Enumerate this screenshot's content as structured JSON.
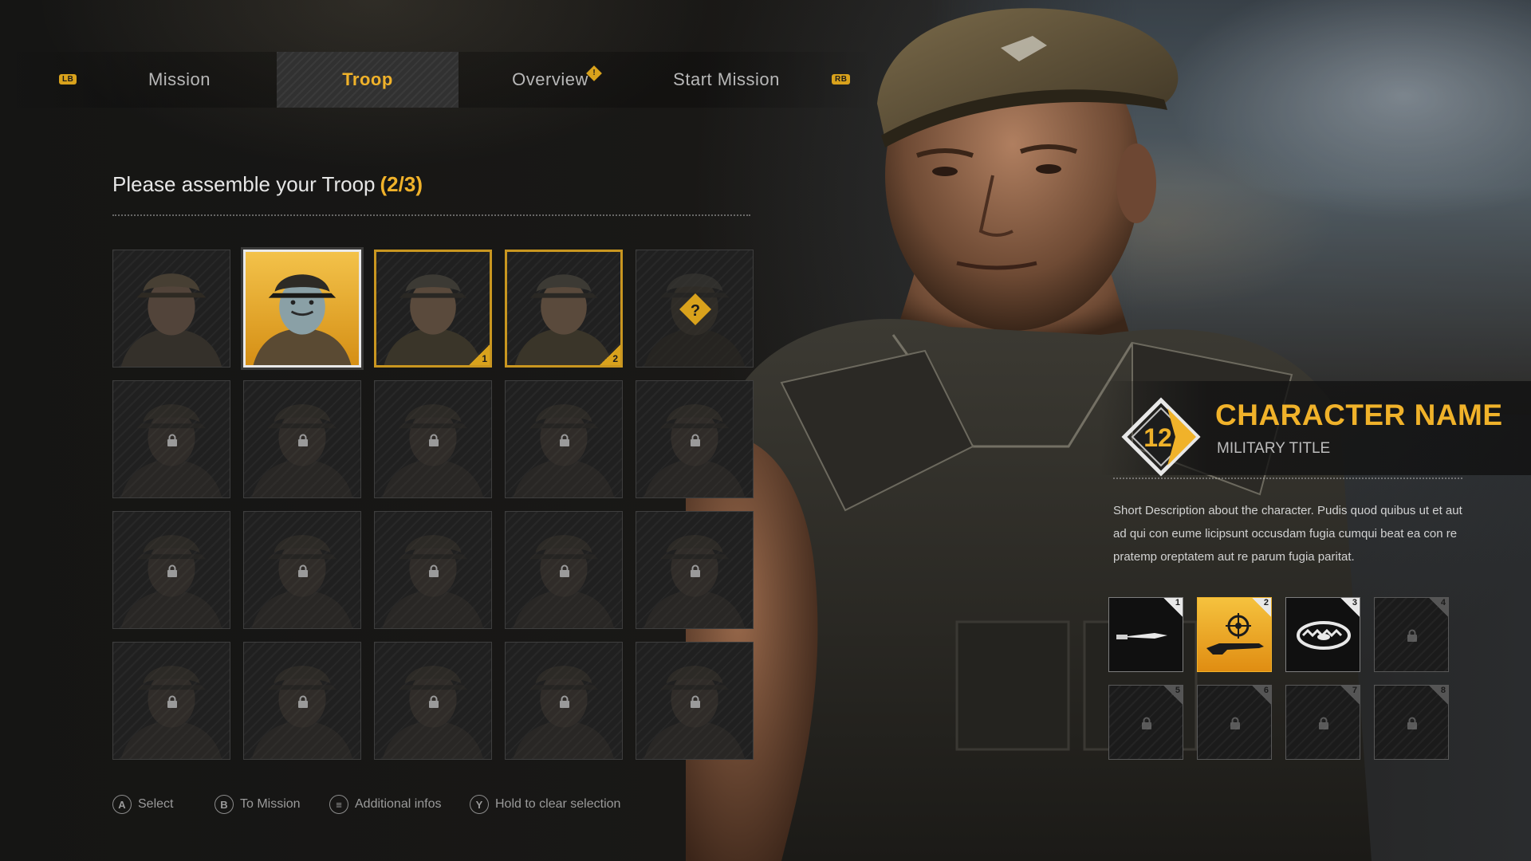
{
  "tabs": {
    "left_bumper": "LB",
    "right_bumper": "RB",
    "items": [
      {
        "label": "Mission"
      },
      {
        "label": "Troop"
      },
      {
        "label": "Overview"
      },
      {
        "label": "Start Mission"
      }
    ],
    "active": "Troop",
    "overview_alert": "!"
  },
  "heading": {
    "text": "Please assemble your Troop",
    "count": "(2/3)"
  },
  "roster": {
    "cells": [
      {
        "state": "available"
      },
      {
        "state": "selected"
      },
      {
        "state": "picked",
        "order": "1"
      },
      {
        "state": "picked",
        "order": "2"
      },
      {
        "state": "mystery",
        "symbol": "?"
      },
      {
        "state": "locked"
      },
      {
        "state": "locked"
      },
      {
        "state": "locked"
      },
      {
        "state": "locked"
      },
      {
        "state": "locked"
      },
      {
        "state": "locked"
      },
      {
        "state": "locked"
      },
      {
        "state": "locked"
      },
      {
        "state": "locked"
      },
      {
        "state": "locked"
      },
      {
        "state": "locked"
      },
      {
        "state": "locked"
      },
      {
        "state": "locked"
      },
      {
        "state": "locked"
      },
      {
        "state": "locked"
      }
    ]
  },
  "controls": [
    {
      "button": "A",
      "label": "Select"
    },
    {
      "button": "B",
      "label": "To Mission"
    },
    {
      "button": "≡",
      "label": "Additional infos"
    },
    {
      "button": "Y",
      "label": "Hold to clear selection"
    }
  ],
  "character": {
    "level": "12",
    "name": "CHARACTER NAME",
    "title": "MILITARY TITLE",
    "description": "Short Description about the character. Pudis quod quibus ut et aut ad qui con eume licipsunt occusdam fugia cumqui beat ea con re pratemp oreptatem aut re parum fugia paritat."
  },
  "loadout": [
    {
      "slot": "1",
      "item": "knife-icon",
      "state": "equipped"
    },
    {
      "slot": "2",
      "item": "sniper-rifle-icon",
      "state": "active"
    },
    {
      "slot": "3",
      "item": "bear-trap-icon",
      "state": "equipped"
    },
    {
      "slot": "4",
      "item": "lock-icon",
      "state": "locked"
    },
    {
      "slot": "5",
      "item": "lock-icon",
      "state": "locked"
    },
    {
      "slot": "6",
      "item": "lock-icon",
      "state": "locked"
    },
    {
      "slot": "7",
      "item": "lock-icon",
      "state": "locked"
    },
    {
      "slot": "8",
      "item": "lock-icon",
      "state": "locked"
    }
  ],
  "colors": {
    "accent": "#f0b22a",
    "background": "#141414",
    "text": "#cfcfcf"
  }
}
